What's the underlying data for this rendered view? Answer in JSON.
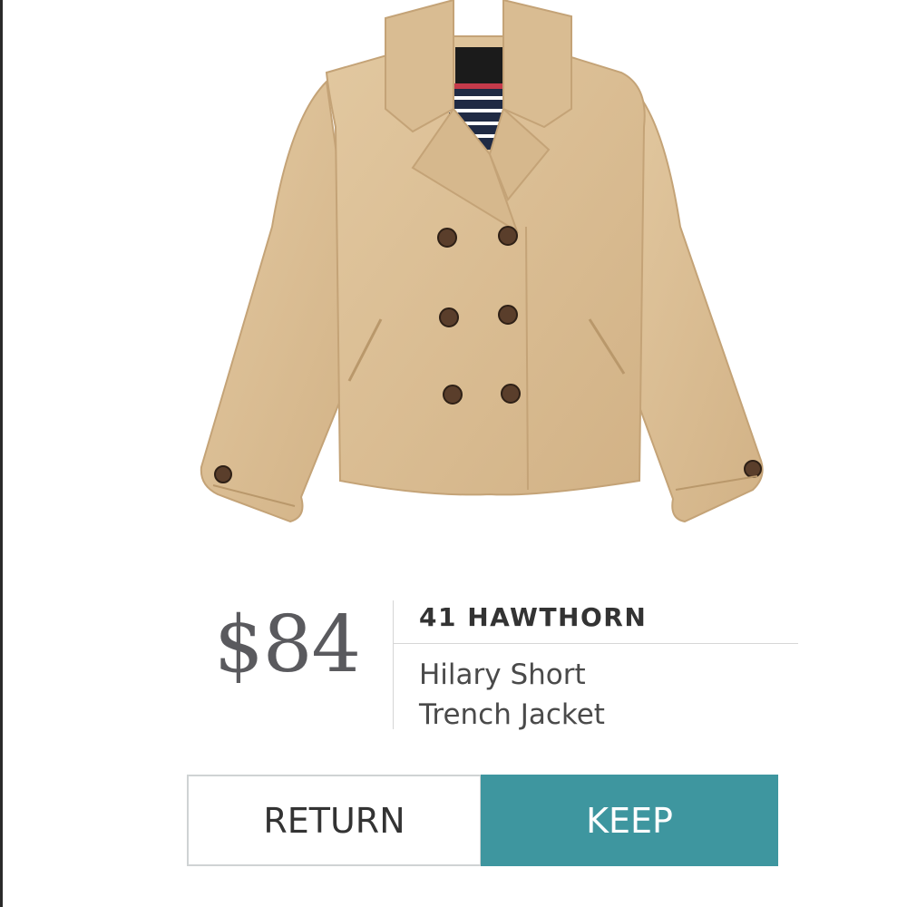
{
  "product": {
    "price": "$84",
    "brand": "41 HAWTHORN",
    "name_line1": "Hilary Short",
    "name_line2": "Trench Jacket",
    "image_icon": "trench-jacket-photo",
    "coat_color": "#d8b98c"
  },
  "actions": {
    "return_label": "RETURN",
    "keep_label": "KEEP",
    "keep_color": "#3e969f"
  }
}
